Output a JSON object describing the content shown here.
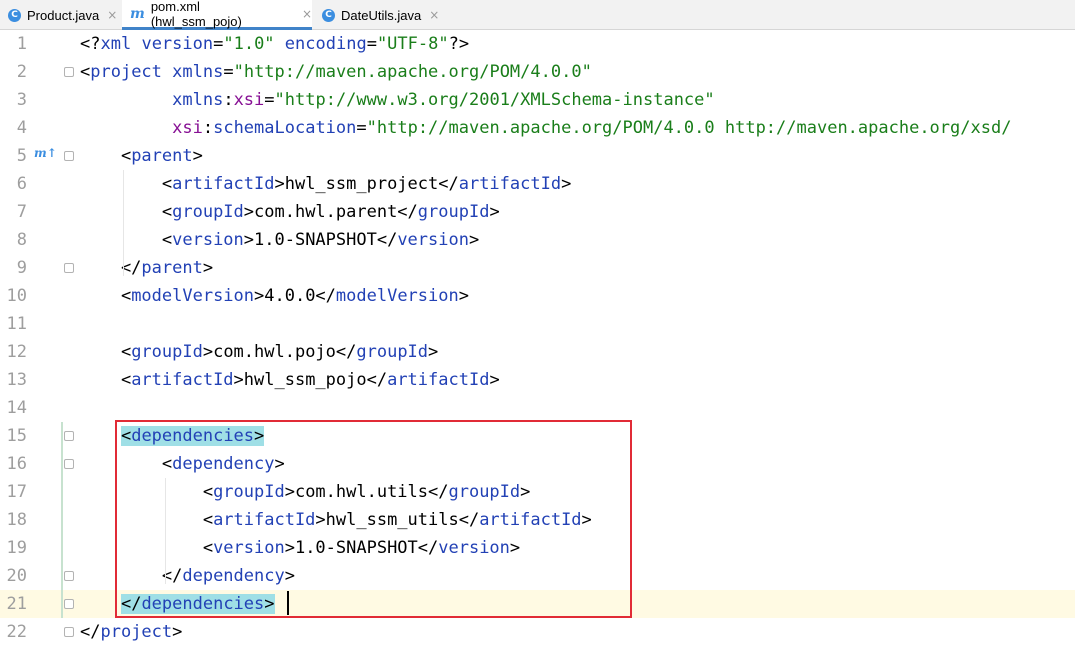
{
  "tabs": [
    {
      "label": "Product.java",
      "icon": "c-class-icon",
      "active": false
    },
    {
      "label": "pom.xml (hwl_ssm_pojo)",
      "icon": "maven-m-icon",
      "active": true
    },
    {
      "label": "DateUtils.java",
      "icon": "c-class-icon",
      "active": false
    }
  ],
  "close_glyph": "×",
  "gutter": {
    "line_numbers": [
      "1",
      "2",
      "3",
      "4",
      "5",
      "6",
      "7",
      "8",
      "9",
      "10",
      "11",
      "12",
      "13",
      "14",
      "15",
      "16",
      "17",
      "18",
      "19",
      "20",
      "21",
      "22"
    ],
    "marker_label": "m↑"
  },
  "code": {
    "lines": [
      "<?xml version=\"1.0\" encoding=\"UTF-8\"?>",
      "<project xmlns=\"http://maven.apache.org/POM/4.0.0\"",
      "         xmlns:xsi=\"http://www.w3.org/2001/XMLSchema-instance\"",
      "         xsi:schemaLocation=\"http://maven.apache.org/POM/4.0.0 http://maven.apache.org/xsd/",
      "    <parent>",
      "        <artifactId>hwl_ssm_project</artifactId>",
      "        <groupId>com.hwl.parent</groupId>",
      "        <version>1.0-SNAPSHOT</version>",
      "    </parent>",
      "    <modelVersion>4.0.0</modelVersion>",
      "",
      "    <groupId>com.hwl.pojo</groupId>",
      "    <artifactId>hwl_ssm_pojo</artifactId>",
      "",
      "    <dependencies>",
      "        <dependency>",
      "            <groupId>com.hwl.utils</groupId>",
      "            <artifactId>hwl_ssm_utils</artifactId>",
      "            <version>1.0-SNAPSHOT</version>",
      "        </dependency>",
      "    </dependencies>",
      "</project>"
    ],
    "current_line": 21
  },
  "colors": {
    "tag": "#2241b5",
    "attr_ns": "#871094",
    "string": "#1a7e1a",
    "highlight": "#9fdfe6",
    "current_line": "#fffae3",
    "selection_box": "#e12b36",
    "active_tab_underline": "#4083c9"
  }
}
